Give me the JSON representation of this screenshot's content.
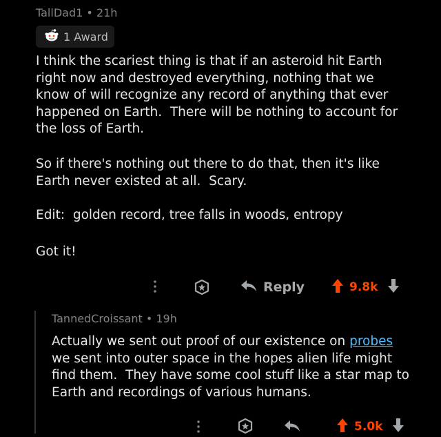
{
  "comment1": {
    "author": "TallDad1",
    "separator": "•",
    "age": "21h",
    "award_label": "1 Award",
    "paragraphs": [
      "I think the scariest thing is that if an asteroid hit Earth\nright now and destroyed everything, nothing that we\nknow of will recognize any record of anything that ever\nhappened on Earth.  There will be nothing to account for\nthe loss of Earth.",
      "So if there's nothing out there to do that, then it's like\nEarth never existed at all.  Scary.",
      "Edit:  golden record, tree falls in woods, entropy",
      "Got it!"
    ],
    "actions": {
      "reply_label": "Reply",
      "score": "9.8k"
    }
  },
  "comment2": {
    "author": "TannedCroissant",
    "separator": "•",
    "age": "19h",
    "text_before_link": "Actually we sent out proof of our existence on ",
    "link_text": "probes",
    "text_after_link": "\nwe sent into outer space in the hopes alien life might\nfind them.  They have some cool stuff like a star map to\nEarth and recordings of various humans.",
    "actions": {
      "score": "5.0k"
    }
  },
  "colors": {
    "upvote": "#ff4500",
    "link": "#4fbcff",
    "background": "#000000"
  }
}
